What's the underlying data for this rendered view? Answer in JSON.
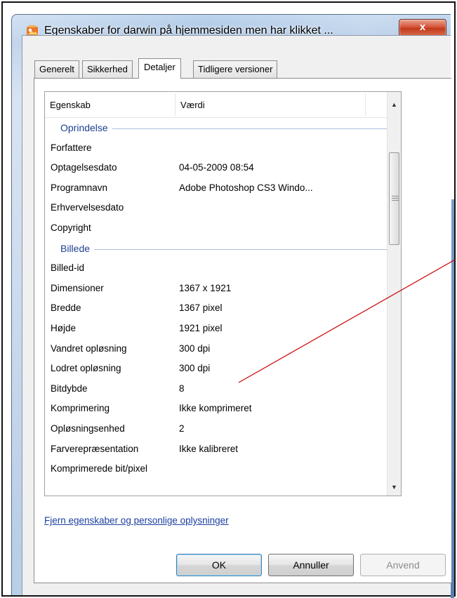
{
  "window": {
    "title": "Egenskaber for darwin på hjemmesiden men har klikket ...",
    "close_label": "x"
  },
  "tabs": [
    {
      "label": "Generelt",
      "active": false
    },
    {
      "label": "Sikkerhed",
      "active": false
    },
    {
      "label": "Detaljer",
      "active": true
    },
    {
      "label": "Tidligere versioner",
      "active": false
    }
  ],
  "list": {
    "columns": [
      "Egenskab",
      "Værdi"
    ],
    "groups": [
      {
        "name": "Oprindelse",
        "rows": [
          {
            "key": "Forfattere",
            "value": ""
          },
          {
            "key": "Optagelsesdato",
            "value": "04-05-2009 08:54"
          },
          {
            "key": "Programnavn",
            "value": "Adobe Photoshop CS3 Windo..."
          },
          {
            "key": "Erhvervelsesdato",
            "value": ""
          },
          {
            "key": "Copyright",
            "value": ""
          }
        ]
      },
      {
        "name": "Billede",
        "rows": [
          {
            "key": "Billed-id",
            "value": ""
          },
          {
            "key": "Dimensioner",
            "value": "1367 x 1921"
          },
          {
            "key": "Bredde",
            "value": "1367 pixel"
          },
          {
            "key": "Højde",
            "value": "1921 pixel"
          },
          {
            "key": "Vandret opløsning",
            "value": "300 dpi"
          },
          {
            "key": "Lodret opløsning",
            "value": "300 dpi"
          },
          {
            "key": "Bitdybde",
            "value": "8"
          },
          {
            "key": "Komprimering",
            "value": "Ikke komprimeret"
          },
          {
            "key": "Opløsningsenhed",
            "value": "2"
          },
          {
            "key": "Farverepræsentation",
            "value": "Ikke kalibreret"
          },
          {
            "key": "Komprimerede bit/pixel",
            "value": ""
          }
        ]
      }
    ]
  },
  "link": {
    "label": "Fjern egenskaber og personlige oplysninger"
  },
  "buttons": {
    "ok": "OK",
    "cancel": "Annuller",
    "apply": "Anvend"
  },
  "colors": {
    "group_header": "#1e3f8f",
    "link": "#1c3fa1",
    "annotation_line": "#cc0000"
  }
}
